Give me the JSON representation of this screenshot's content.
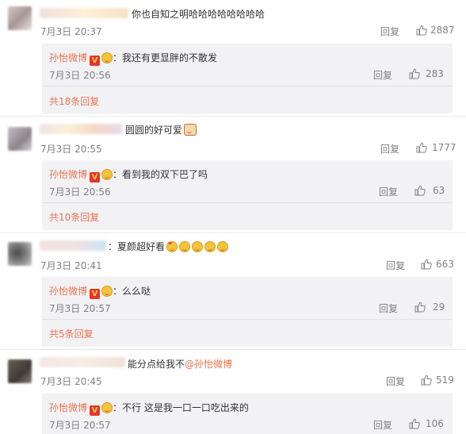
{
  "comments": [
    {
      "text": "你也自知之明哈哈哈哈哈哈哈哈",
      "emoji_after": "",
      "time": "7月3日 20:37",
      "reply_label": "回复",
      "likes": "2887",
      "reply": {
        "author": "孙怡微博",
        "text": "我还有更显胖的不散发",
        "time": "7月3日 20:56",
        "reply_label": "回复",
        "likes": "283"
      },
      "more": "共18条回复"
    },
    {
      "text": "圆圆的好可爱",
      "emoji_after": "cat",
      "time": "7月3日 20:55",
      "reply_label": "回复",
      "likes": "1777",
      "reply": {
        "author": "孙怡微博",
        "text": "看到我的双下巴了吗",
        "time": "7月3日 20:56",
        "reply_label": "回复",
        "likes": "63"
      },
      "more": "共10条回复"
    },
    {
      "text": "：夏颜超好看",
      "emoji_after": "love",
      "time": "7月3日 20:41",
      "reply_label": "回复",
      "likes": "663",
      "reply": {
        "author": "孙怡微博",
        "text": "么么哒",
        "time": "7月3日 20:57",
        "reply_label": "回复",
        "likes": "29"
      },
      "more": "共5条回复"
    },
    {
      "text": "能分点给我不",
      "mention": "@孙怡微博",
      "time": "7月3日 20:45",
      "reply_label": "回复",
      "likes": "519",
      "reply": {
        "author": "孙怡微博",
        "text": "不行 这是我一口一口吃出来的",
        "time": "7月3日 20:57",
        "reply_label": "回复",
        "likes": "106"
      }
    }
  ],
  "icons": {
    "like": "thumb-up-icon",
    "verified": "v-badge-icon",
    "emoji": "emoji-icon"
  },
  "colors": {
    "accent": "#eb7350",
    "meta": "#808080",
    "reply_bg": "#f2f2f5"
  }
}
